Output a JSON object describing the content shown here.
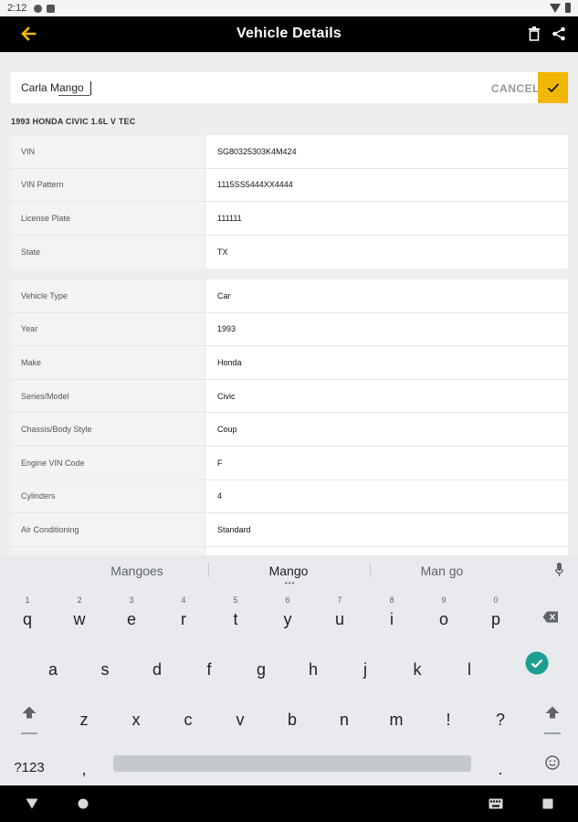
{
  "status_bar": {
    "time": "2:12"
  },
  "app_bar": {
    "title": "Vehicle Details"
  },
  "name_field": {
    "value": "Carla Mango",
    "cancel_label": "CANCEL"
  },
  "vehicle_title": "1993 HONDA CIVIC 1.6L V TEC",
  "registration": [
    {
      "label": "VIN",
      "value": "SG80325303K4M424"
    },
    {
      "label": "VIN Pattern",
      "value": "1115SS5444XX4444"
    },
    {
      "label": "License Plate",
      "value": "111111"
    },
    {
      "label": "State",
      "value": "TX"
    }
  ],
  "specs": [
    {
      "label": "Vehicle Type",
      "value": "Car"
    },
    {
      "label": "Year",
      "value": "1993"
    },
    {
      "label": "Make",
      "value": "Honda"
    },
    {
      "label": "Series/Model",
      "value": "Civic"
    },
    {
      "label": "Chassis/Body Style",
      "value": "Coup"
    },
    {
      "label": "Engine VIN Code",
      "value": "F"
    },
    {
      "label": "Cylinders",
      "value": "4"
    },
    {
      "label": "Air Conditioning",
      "value": "Standard"
    }
  ],
  "suggestions": [
    "Mangoes",
    "Mango",
    "Man go"
  ],
  "keyboard": {
    "row1": [
      {
        "k": "q",
        "d": "1"
      },
      {
        "k": "w",
        "d": "2"
      },
      {
        "k": "e",
        "d": "3"
      },
      {
        "k": "r",
        "d": "4"
      },
      {
        "k": "t",
        "d": "5"
      },
      {
        "k": "y",
        "d": "6"
      },
      {
        "k": "u",
        "d": "7"
      },
      {
        "k": "i",
        "d": "8"
      },
      {
        "k": "o",
        "d": "9"
      },
      {
        "k": "p",
        "d": "0"
      }
    ],
    "row2": [
      "a",
      "s",
      "d",
      "f",
      "g",
      "h",
      "j",
      "k",
      "l"
    ],
    "row3": [
      "z",
      "x",
      "c",
      "v",
      "b",
      "n",
      "m",
      "!",
      "?"
    ],
    "symbols_label": "?123",
    "comma": ",",
    "period": "."
  },
  "colors": {
    "accent": "#f2b705",
    "app_bar": "#000000",
    "enter_key": "#1a9e91"
  },
  "icons": [
    "back-arrow-icon",
    "trash-icon",
    "share-icon",
    "check-icon",
    "mic-icon",
    "backspace-icon",
    "shift-icon",
    "emoji-icon",
    "keyboard-icon"
  ]
}
